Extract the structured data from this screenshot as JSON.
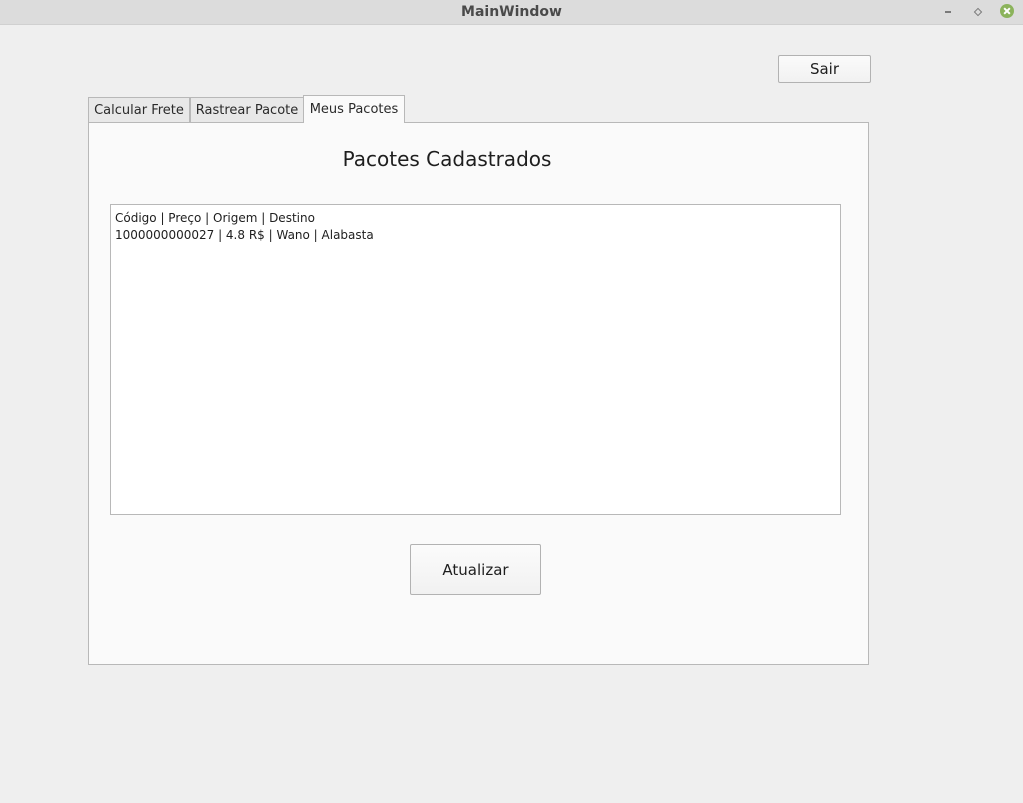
{
  "window": {
    "title": "MainWindow"
  },
  "header": {
    "exit_label": "Sair"
  },
  "tabs": [
    {
      "label": "Calcular Frete"
    },
    {
      "label": "Rastrear Pacote"
    },
    {
      "label": "Meus Pacotes"
    }
  ],
  "active_tab": "Meus Pacotes",
  "main": {
    "title": "Pacotes Cadastrados",
    "list_lines": [
      "Código | Preço | Origem | Destino",
      "1000000000027 | 4.8 R$ | Wano | Alabasta"
    ],
    "refresh_label": "Atualizar"
  },
  "colors": {
    "window_bg": "#efefef",
    "panel_bg": "#fafafa",
    "close_button": "#8bb35b"
  }
}
